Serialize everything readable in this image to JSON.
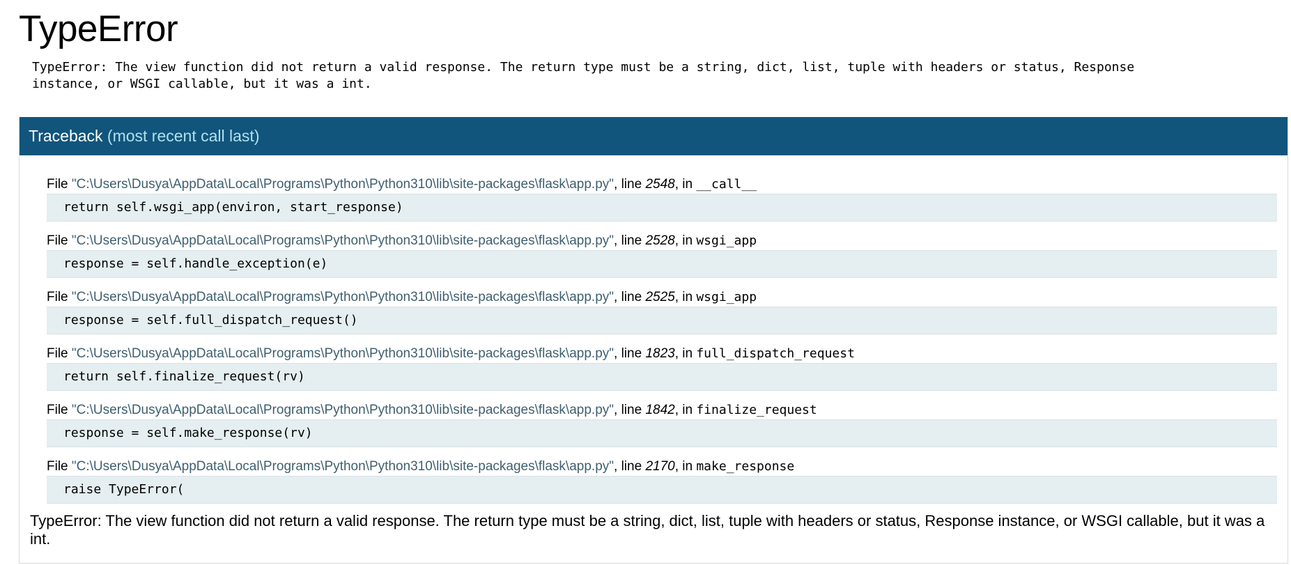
{
  "title": "TypeError",
  "error_message": "TypeError: The view function did not return a valid response. The return type must be a string, dict, list, tuple with headers or status, Response\ninstance, or WSGI callable, but it was a int.",
  "traceback": {
    "heading": "Traceback",
    "heading_sub": "(most recent call last)",
    "file_label": "File ",
    "line_label": ", line ",
    "in_label": ", in ",
    "frames": [
      {
        "filename": "\"C:\\Users\\Dusya\\AppData\\Local\\Programs\\Python\\Python310\\lib\\site-packages\\flask\\app.py\"",
        "lineno": "2548",
        "function": "__call__",
        "code": "return self.wsgi_app(environ, start_response)"
      },
      {
        "filename": "\"C:\\Users\\Dusya\\AppData\\Local\\Programs\\Python\\Python310\\lib\\site-packages\\flask\\app.py\"",
        "lineno": "2528",
        "function": "wsgi_app",
        "code": "response = self.handle_exception(e)"
      },
      {
        "filename": "\"C:\\Users\\Dusya\\AppData\\Local\\Programs\\Python\\Python310\\lib\\site-packages\\flask\\app.py\"",
        "lineno": "2525",
        "function": "wsgi_app",
        "code": "response = self.full_dispatch_request()"
      },
      {
        "filename": "\"C:\\Users\\Dusya\\AppData\\Local\\Programs\\Python\\Python310\\lib\\site-packages\\flask\\app.py\"",
        "lineno": "1823",
        "function": "full_dispatch_request",
        "code": "return self.finalize_request(rv)"
      },
      {
        "filename": "\"C:\\Users\\Dusya\\AppData\\Local\\Programs\\Python\\Python310\\lib\\site-packages\\flask\\app.py\"",
        "lineno": "1842",
        "function": "finalize_request",
        "code": "response = self.make_response(rv)"
      },
      {
        "filename": "\"C:\\Users\\Dusya\\AppData\\Local\\Programs\\Python\\Python310\\lib\\site-packages\\flask\\app.py\"",
        "lineno": "2170",
        "function": "make_response",
        "code": "raise TypeError("
      }
    ],
    "final_error": "TypeError: The view function did not return a valid response. The return type must be a string, dict, list, tuple with headers or status, Response instance, or WSGI callable, but it was a int."
  },
  "colors": {
    "header_bg": "#11557c",
    "header_sub": "#b0e0ee",
    "filename": "#3f5f6f",
    "code_bg": "#e5eef0"
  }
}
